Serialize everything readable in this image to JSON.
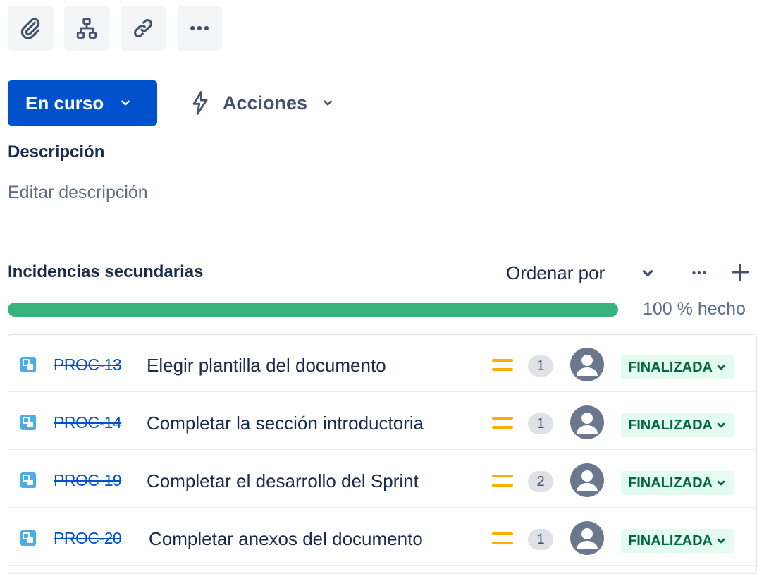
{
  "toolbar": {
    "buttons": [
      {
        "icon": "paperclip-icon"
      },
      {
        "icon": "hierarchy-icon"
      },
      {
        "icon": "link-icon"
      },
      {
        "icon": "more-icon"
      }
    ]
  },
  "status_button": {
    "label": "En curso"
  },
  "actions_button": {
    "label": "Acciones",
    "icon": "lightning-icon"
  },
  "description": {
    "heading": "Descripción",
    "placeholder": "Editar descripción"
  },
  "subtasks": {
    "heading": "Incidencias secundarias",
    "sort_label": "Ordenar por",
    "progress": {
      "percent": 100,
      "label": "100 % hecho"
    },
    "items": [
      {
        "key": "PROC-13",
        "summary": "Elegir plantilla del documento",
        "count": "1",
        "status": "FINALIZADA"
      },
      {
        "key": "PROC-14",
        "summary": "Completar la sección introductoria",
        "count": "1",
        "status": "FINALIZADA"
      },
      {
        "key": "PROC-19",
        "summary": "Completar el desarrollo del Sprint",
        "count": "2",
        "status": "FINALIZADA"
      },
      {
        "key": "PROC-20",
        "summary": "Completar anexos del documento",
        "count": "1",
        "status": "FINALIZADA"
      }
    ]
  },
  "colors": {
    "primary": "#0052cc",
    "progress": "#36b37e",
    "priority_medium": "#ffab00",
    "done_bg": "#e3fcef",
    "done_text": "#006644"
  }
}
